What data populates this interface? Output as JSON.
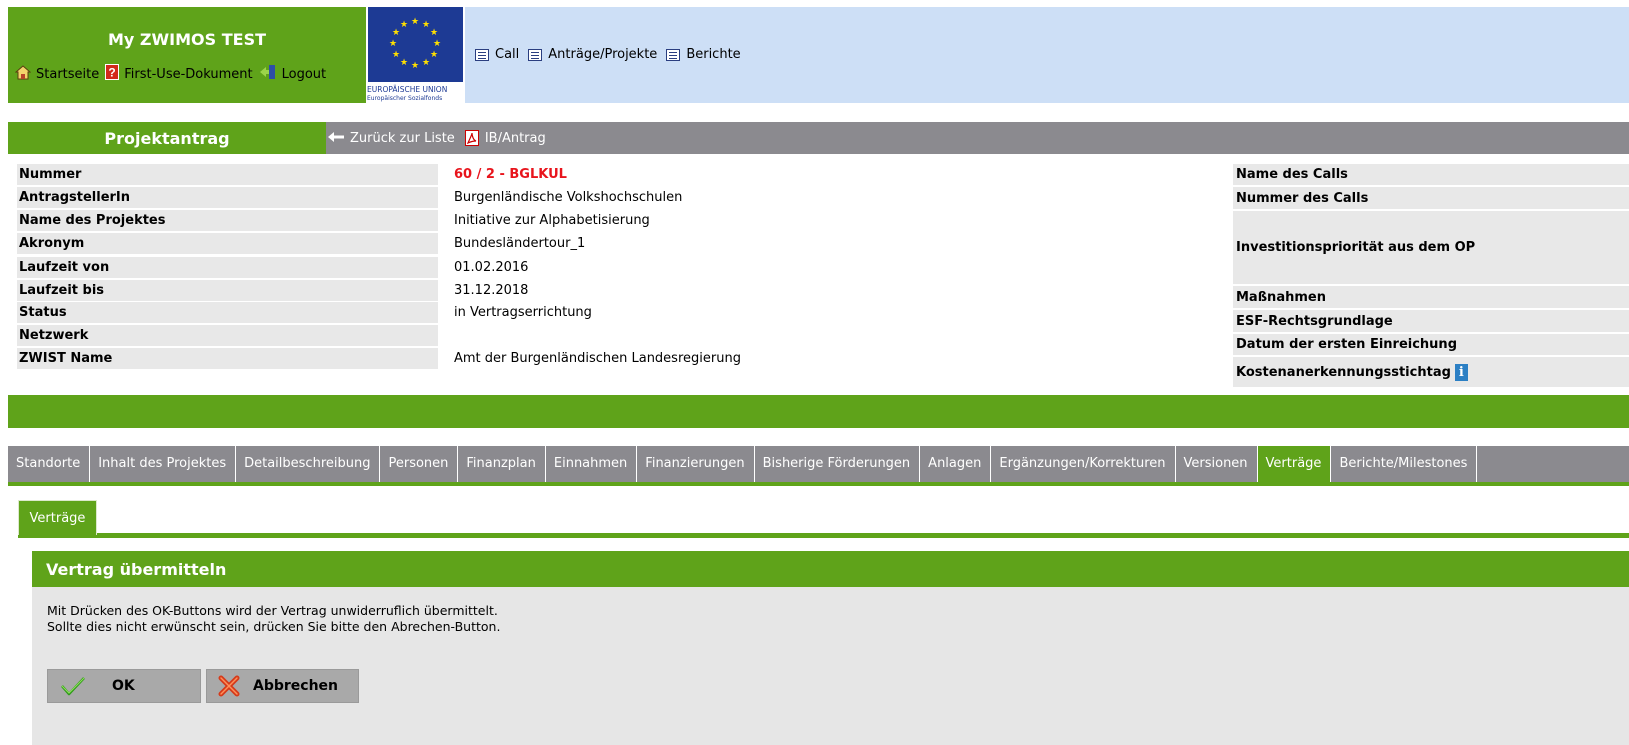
{
  "header": {
    "app_title": "My ZWIMOS TEST",
    "links": [
      "Startseite",
      "First-Use-Dokument",
      "Logout"
    ],
    "eu_logo_line1": "EUROPÄISCHE UNION",
    "eu_logo_line2": "Europäischer Sozialfonds",
    "nav": [
      "Call",
      "Anträge/Projekte",
      "Berichte"
    ]
  },
  "toolbar": {
    "section": "Projektantrag",
    "back_label": "Zurück zur Liste",
    "pdf_label": "IB/Antrag"
  },
  "details": {
    "labels": [
      "Nummer",
      "AntragstellerIn",
      "Name des Projektes",
      "Akronym",
      "Laufzeit von",
      "Laufzeit bis",
      "Status",
      "Netzwerk",
      "ZWIST Name"
    ],
    "values": [
      "60 / 2 - BGLKUL",
      "Burgenländische Volkshochschulen",
      "Initiative zur Alphabetisierung",
      "Bundesländertour_1",
      "01.02.2016",
      "31.12.2018",
      "in Vertragserrichtung",
      "",
      "Amt der Burgenländischen Landesregierung"
    ],
    "right_labels": [
      "Name des Calls",
      "Nummer des Calls",
      "Investitionspriorität aus dem OP",
      "Maßnahmen",
      "ESF-Rechtsgrundlage",
      "Datum der ersten Einreichung",
      "Kostenanerkennungsstichtag"
    ]
  },
  "tabs": [
    "Standorte",
    "Inhalt des Projektes",
    "Detailbeschreibung",
    "Personen",
    "Finanzplan",
    "Einnahmen",
    "Finanzierungen",
    "Bisherige Förderungen",
    "Anlagen",
    "Ergänzungen/Korrekturen",
    "Versionen",
    "Verträge",
    "Berichte/Milestones"
  ],
  "active_tab": "Verträge",
  "subtab": "Verträge",
  "panel": {
    "title": "Vertrag übermitteln",
    "message_line1": "Mit Drücken des OK-Buttons wird der Vertrag unwiderruflich übermittelt.",
    "message_line2": "Sollte dies nicht erwünscht sein, drücken Sie bitte den Abrechen-Button.",
    "ok_label": "OK",
    "cancel_label": "Abbrechen"
  },
  "colors": {
    "green": "#5fa31a",
    "gray_bar": "#8b8a8f",
    "light_blue": "#cddff6",
    "number_red": "#e8141c",
    "eu_blue": "#1d3a94"
  }
}
